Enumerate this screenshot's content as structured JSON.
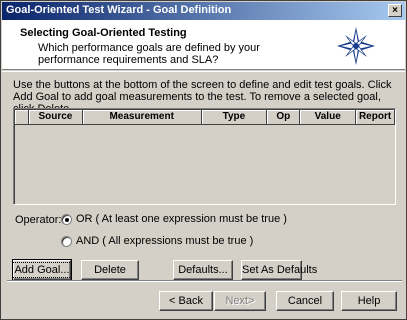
{
  "window": {
    "title": "Goal-Oriented Test Wizard - Goal Definition",
    "close_glyph": "×"
  },
  "header": {
    "title": "Selecting Goal-Oriented Testing",
    "subtitle": "Which performance goals are defined by your performance requirements and SLA?",
    "logo_icon": "compass-star-icon",
    "logo_color": "#1a3c8c"
  },
  "instructions": "Use the buttons at the bottom of the screen to define and edit test goals. Click Add Goal to add goal measurements to the test. To remove a selected goal, click Delete.",
  "table": {
    "columns": [
      "",
      "Source",
      "Measurement",
      "Type",
      "Op",
      "Value",
      "Report"
    ],
    "rows": []
  },
  "operator": {
    "label": "Operator:",
    "options": [
      {
        "label": "OR ( At least one expression must be true )",
        "selected": true
      },
      {
        "label": "AND ( All expressions must be true )",
        "selected": false
      }
    ]
  },
  "actions": {
    "add_goal": "Add Goal...",
    "delete": "Delete",
    "defaults": "Defaults...",
    "set_as_defaults": "Set As Defaults"
  },
  "nav": {
    "back": "< Back",
    "next": "Next>",
    "cancel": "Cancel",
    "help": "Help"
  }
}
